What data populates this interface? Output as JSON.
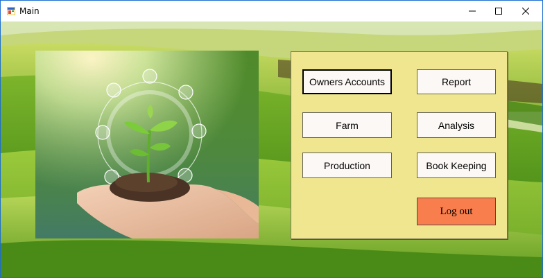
{
  "window": {
    "title": "Main",
    "controls": {
      "minimize_icon": "minimize-icon",
      "maximize_icon": "maximize-icon",
      "close_icon": "close-icon"
    }
  },
  "background": {
    "description_icon": "green-hills-landscape"
  },
  "picture": {
    "icon": "plant-in-hands-image"
  },
  "menu": {
    "owners_accounts": "Owners Accounts",
    "report": "Report",
    "farm": "Farm",
    "analysis": "Analysis",
    "production": "Production",
    "book_keeping": "Book Keeping",
    "log_out": "Log out"
  },
  "colors": {
    "panel": "#efe68f",
    "button": "#fcf8f6",
    "logout": "#f97e4d",
    "window_border": "#1d6fd1"
  }
}
